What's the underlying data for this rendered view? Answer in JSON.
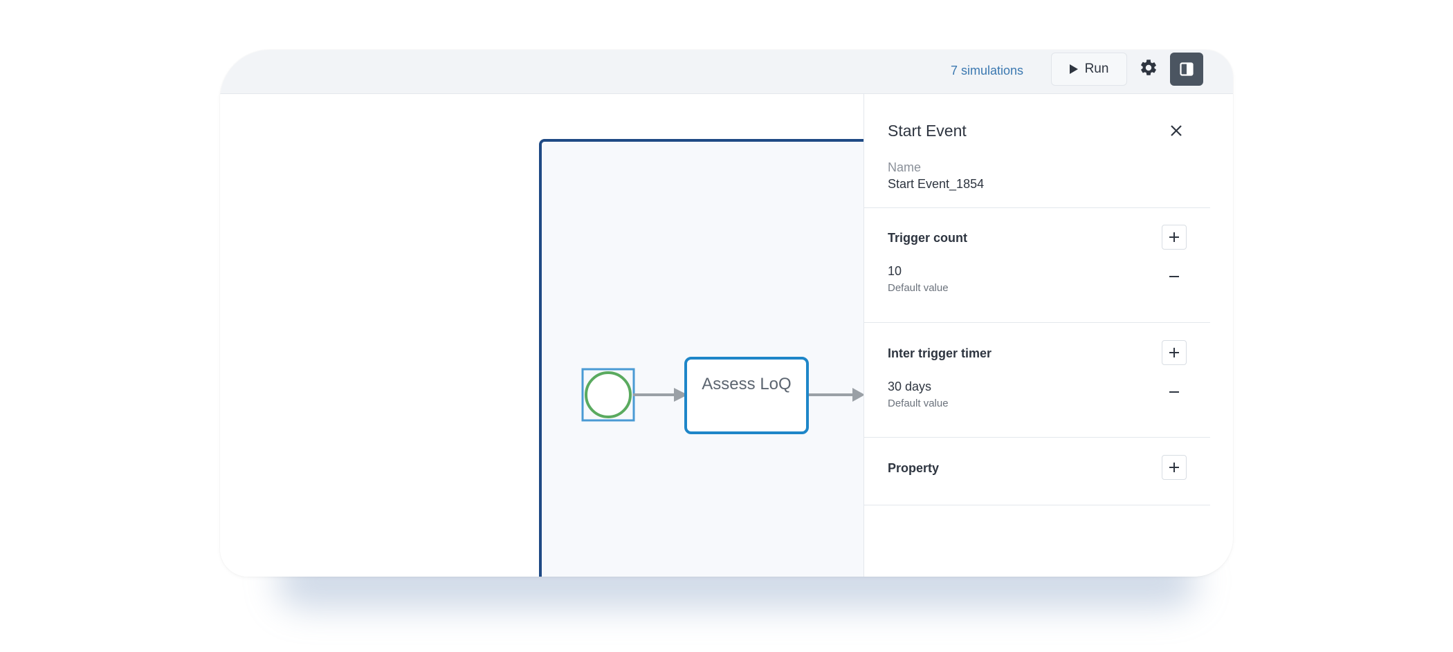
{
  "toolbar": {
    "simulations_link": "7 simulations",
    "run_label": "Run"
  },
  "diagram": {
    "task_label": "Assess LoQ"
  },
  "panel": {
    "title": "Start Event",
    "name_label": "Name",
    "name_value": "Start Event_1854",
    "sections": [
      {
        "title": "Trigger count",
        "value": "10",
        "sub": "Default value"
      },
      {
        "title": "Inter trigger timer",
        "value": "30 days",
        "sub": "Default value"
      },
      {
        "title": "Property"
      }
    ]
  },
  "colors": {
    "accent": "#3b78b0",
    "pool_border": "#1f4a85",
    "start_event": "#5aaa5f",
    "selection": "#4a9ad4",
    "task_border": "#1e86c8",
    "panel_toggle": "#4b5561"
  },
  "icons": [
    "play-icon",
    "gear-icon",
    "sidebar-toggle-icon",
    "close-icon",
    "plus-icon",
    "minus-icon"
  ]
}
